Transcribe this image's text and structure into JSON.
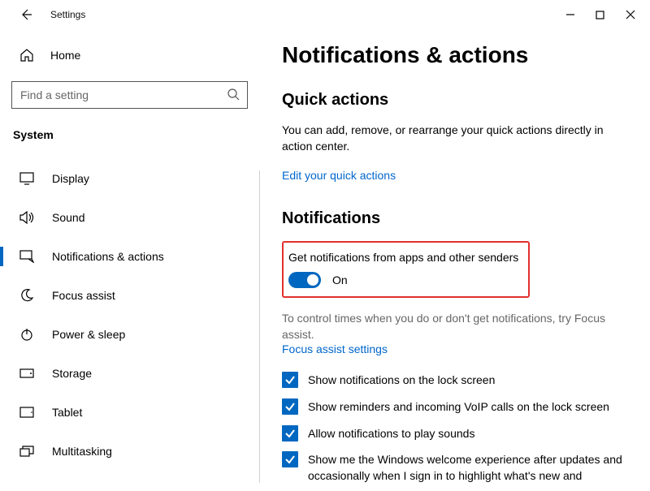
{
  "window": {
    "title": "Settings"
  },
  "sidebar": {
    "home": "Home",
    "search_placeholder": "Find a setting",
    "category": "System",
    "items": [
      {
        "label": "Display"
      },
      {
        "label": "Sound"
      },
      {
        "label": "Notifications & actions"
      },
      {
        "label": "Focus assist"
      },
      {
        "label": "Power & sleep"
      },
      {
        "label": "Storage"
      },
      {
        "label": "Tablet"
      },
      {
        "label": "Multitasking"
      }
    ]
  },
  "content": {
    "h1": "Notifications & actions",
    "quick_actions_h2": "Quick actions",
    "quick_actions_desc": "You can add, remove, or rearrange your quick actions directly in action center.",
    "edit_link": "Edit your quick actions",
    "notifications_h2": "Notifications",
    "toggle_title": "Get notifications from apps and other senders",
    "toggle_state": "On",
    "focus_hint": "To control times when you do or don't get notifications, try Focus assist.",
    "focus_link": "Focus assist settings",
    "checks": [
      "Show notifications on the lock screen",
      "Show reminders and incoming VoIP calls on the lock screen",
      "Allow notifications to play sounds",
      "Show me the Windows welcome experience after updates and occasionally when I sign in to highlight what's new and"
    ]
  }
}
